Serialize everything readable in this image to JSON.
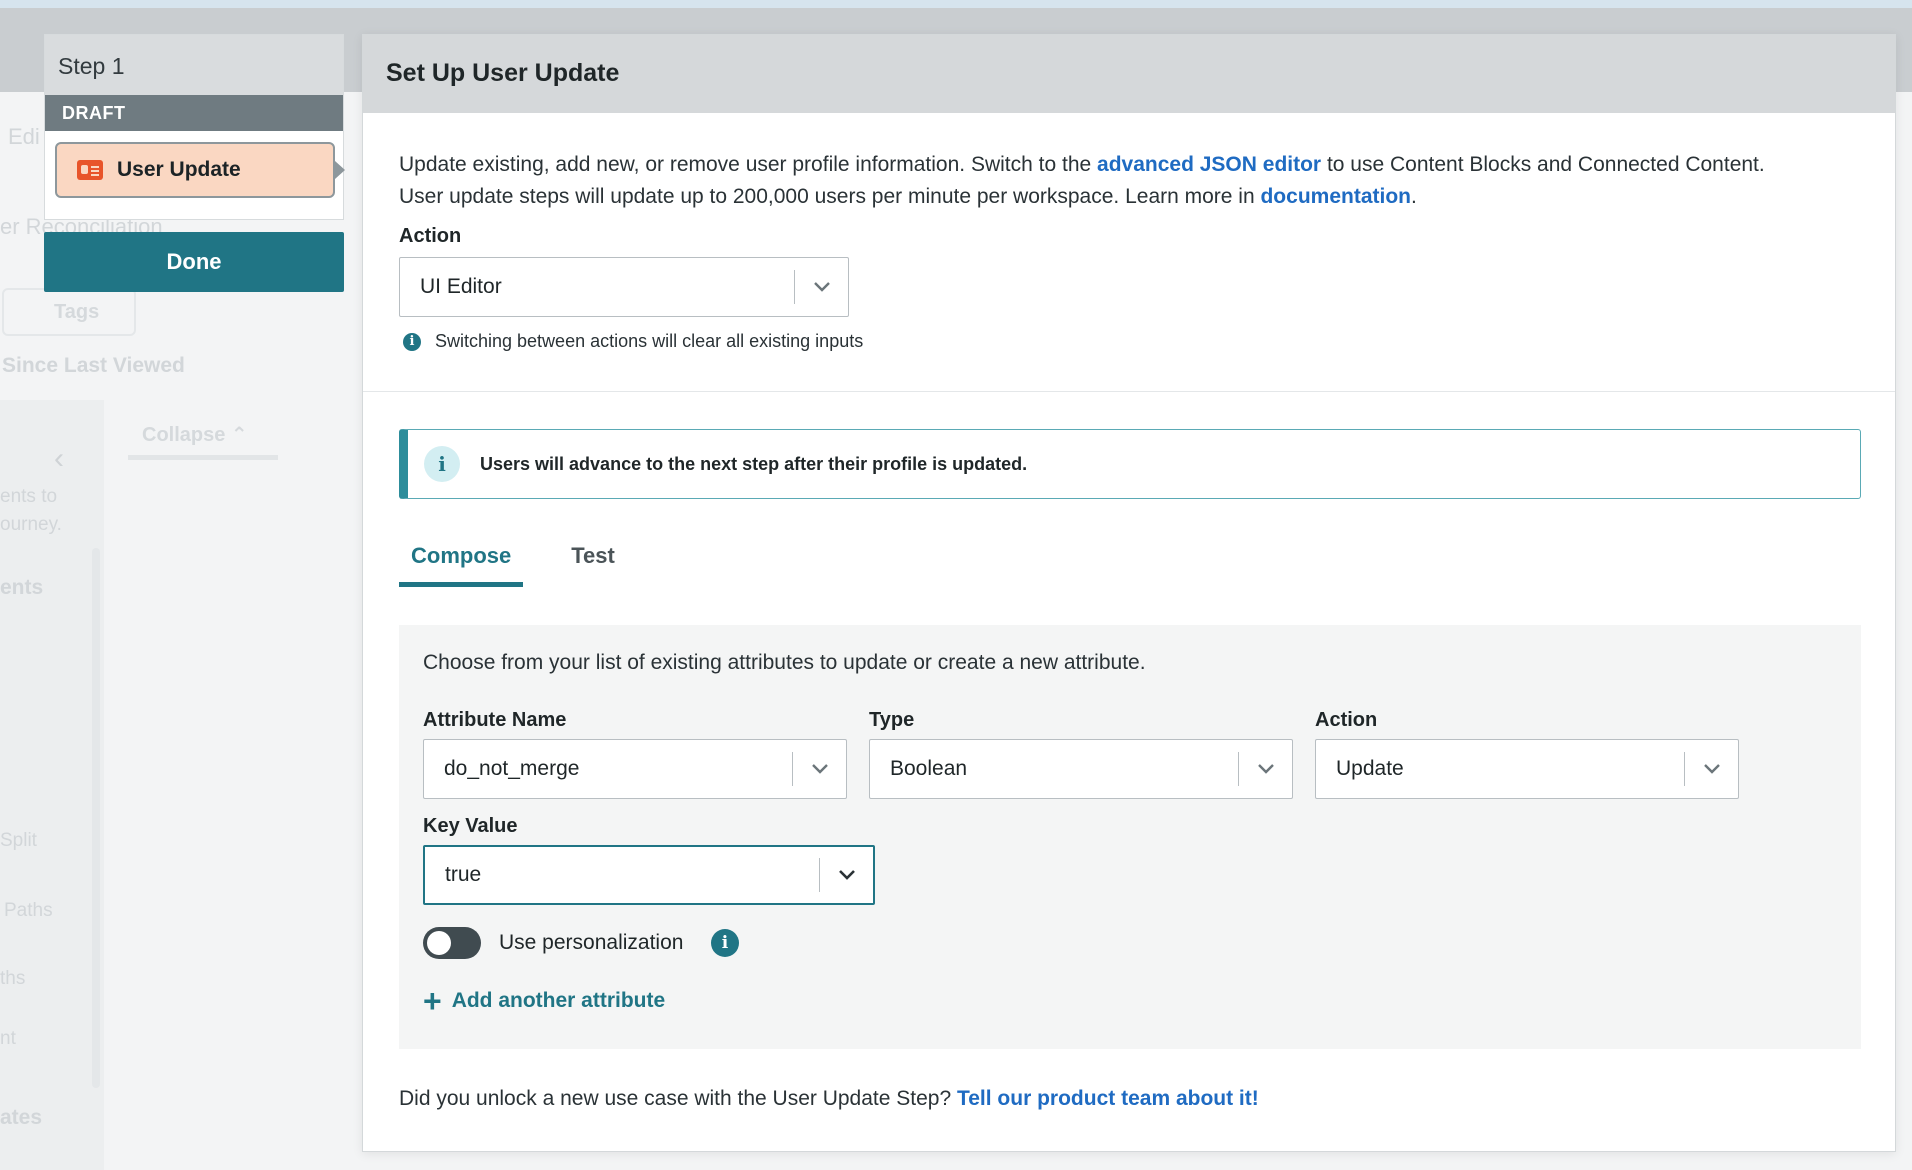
{
  "background": {
    "fragments": {
      "edit": "Edi",
      "reconciliation": "er Reconciliation",
      "tags": "Tags",
      "since_last_viewed": "Since Last Viewed",
      "collapse": "Collapse",
      "ents_to": "ents to",
      "ourney": "ourney.",
      "ents": "ents",
      "split": "Split",
      "paths": "Paths",
      "ths": "ths",
      "nt": "nt",
      "ates": "ates"
    }
  },
  "step_panel": {
    "title": "Step 1",
    "status": "DRAFT",
    "step_name": "User Update",
    "done_label": "Done"
  },
  "modal": {
    "title": "Set Up User Update",
    "intro": {
      "line1_prefix": "Update existing, add new, or remove user profile information. Switch to the ",
      "line1_link": "advanced JSON editor",
      "line1_suffix": " to use Content Blocks and Connected Content.",
      "line2_prefix": "User update steps will update up to 200,000 users per minute per workspace. Learn more in ",
      "line2_link": "documentation",
      "line2_suffix": "."
    },
    "action": {
      "label": "Action",
      "value": "UI Editor",
      "hint": "Switching between actions will clear all existing inputs"
    },
    "banner": "Users will advance to the next step after their profile is updated.",
    "tabs": [
      {
        "label": "Compose",
        "active": true
      },
      {
        "label": "Test",
        "active": false
      }
    ],
    "compose": {
      "note": "Choose from your list of existing attributes to update or create a new attribute.",
      "attribute_name": {
        "label": "Attribute Name",
        "value": "do_not_merge"
      },
      "type": {
        "label": "Type",
        "value": "Boolean"
      },
      "attr_action": {
        "label": "Action",
        "value": "Update"
      },
      "key_value": {
        "label": "Key Value",
        "value": "true"
      },
      "personalization": {
        "label": "Use personalization",
        "enabled": false
      },
      "add_attribute": "Add another attribute"
    },
    "footer": {
      "text": "Did you unlock a new use case with the User Update Step? ",
      "link": "Tell our product team about it!"
    }
  },
  "colors": {
    "accent": "#207585",
    "link": "#1f6bc2",
    "step_card": "#fad7c2",
    "step_icon": "#e8542a"
  }
}
